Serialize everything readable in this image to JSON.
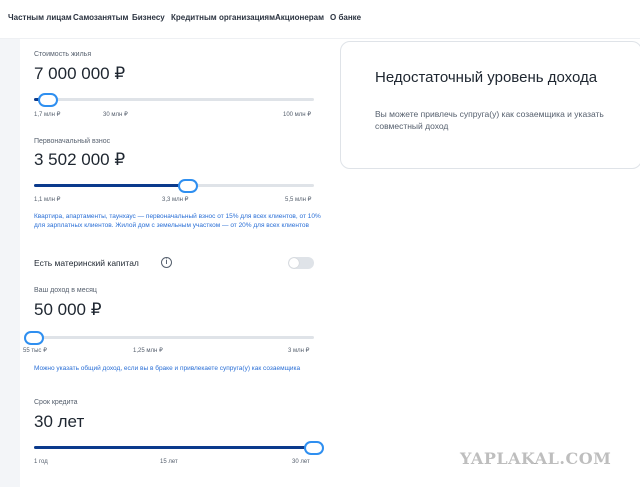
{
  "nav": {
    "items": [
      "Частным лицам",
      "Самозанятым",
      "Бизнесу",
      "Кредитным организациям",
      "Акционерам",
      "О банке"
    ]
  },
  "property_cost": {
    "label": "Стоимость жилья",
    "value": "7 000 000 ₽",
    "ticks": [
      "1,7 млн ₽",
      "30 млн ₽",
      "100 млн ₽"
    ],
    "slider_fraction": 0.05
  },
  "down_payment": {
    "label": "Первоначальный взнос",
    "value": "3 502 000 ₽",
    "ticks": [
      "1,1 млн ₽",
      "3,3 млн ₽",
      "5,5 млн ₽"
    ],
    "slider_fraction": 0.55,
    "note": "Квартира, апартаменты, таунхаус — первоначальный взнос от 15% для всех клиентов, от 10% для зарплатных клиентов. Жилой дом с земельным участком — от 20% для всех клиентов"
  },
  "maternity_capital": {
    "label": "Есть материнский капитал",
    "info_icon": "i",
    "enabled": false
  },
  "income": {
    "label": "Ваш доход в месяц",
    "value": "50 000 ₽",
    "ticks": [
      "55 тыс ₽",
      "1,25 млн ₽",
      "3 млн ₽"
    ],
    "slider_fraction": 0.0,
    "note": "Можно указать общий доход, если вы в браке и привлекаете супруга(у) как созаемщика"
  },
  "term": {
    "label": "Срок кредита",
    "value": "30 лет",
    "ticks": [
      "1 год",
      "15 лет",
      "30 лет"
    ],
    "slider_fraction": 1.0
  },
  "result": {
    "title": "Недостаточный уровень дохода",
    "text": "Вы можете привлечь супруга(у) как созаемщика и указать совместный доход"
  },
  "watermark": "YAPLAKAL.COM",
  "colors": {
    "accent": "#2f8ff0",
    "fill": "#0b3a8c",
    "note": "#2a6fd6"
  }
}
